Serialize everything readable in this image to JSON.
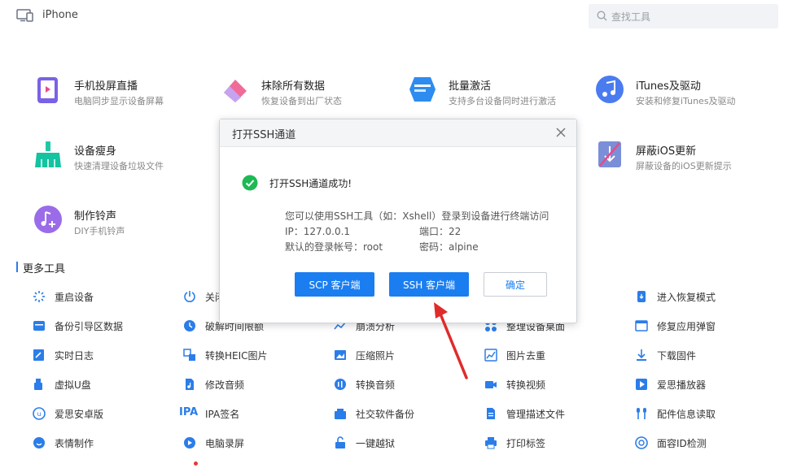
{
  "header": {
    "device": "iPhone",
    "search_placeholder": "查找工具"
  },
  "tiles": [
    {
      "title": "手机投屏直播",
      "desc": "电脑同步显示设备屏幕"
    },
    {
      "title": "抹除所有数据",
      "desc": "恢复设备到出厂状态"
    },
    {
      "title": "批量激活",
      "desc": "支持多台设备同时进行激活"
    },
    {
      "title": "iTunes及驱动",
      "desc": "安装和修复iTunes及驱动"
    },
    {
      "title": "设备瘦身",
      "desc": "快速清理设备垃圾文件"
    },
    {
      "title": "屏蔽iOS更新",
      "desc": "屏蔽设备的iOS更新提示"
    },
    {
      "title": "制作铃声",
      "desc": "DIY手机铃声"
    }
  ],
  "section_label": "更多工具",
  "tools": {
    "col1": [
      "重启设备",
      "备份引导区数据",
      "实时日志",
      "虚拟U盘",
      "爱思安卓版",
      "表情制作"
    ],
    "col2": [
      "关闭",
      "破解时间限额",
      "转换HEIC图片",
      "修改音频",
      "IPA签名",
      "电脑录屏"
    ],
    "col3": [
      "崩溃分析",
      "压缩照片",
      "转换音频",
      "社交软件备份",
      "一键越狱"
    ],
    "col4": [
      "整理设备桌面",
      "图片去重",
      "转换视频",
      "管理描述文件",
      "打印标签"
    ],
    "col5": [
      "进入恢复模式",
      "修复应用弹窗",
      "下载固件",
      "爱思播放器",
      "配件信息读取",
      "面容ID检测"
    ],
    "ipa_prefix": "IPA"
  },
  "dialog": {
    "title": "打开SSH通道",
    "success": "打开SSH通道成功!",
    "line1": "您可以使用SSH工具（如：Xshell）登录到设备进行终端访问",
    "ip": "IP：127.0.0.1",
    "port": "端口：22",
    "account": "默认的登录帐号：root",
    "password": "密码：alpine",
    "btn_scp": "SCP 客户端",
    "btn_ssh": "SSH 客户端",
    "btn_ok": "确定"
  },
  "colors": {
    "accent": "#1a7ef1",
    "success": "#1db954",
    "arrow": "#e02b2b"
  }
}
